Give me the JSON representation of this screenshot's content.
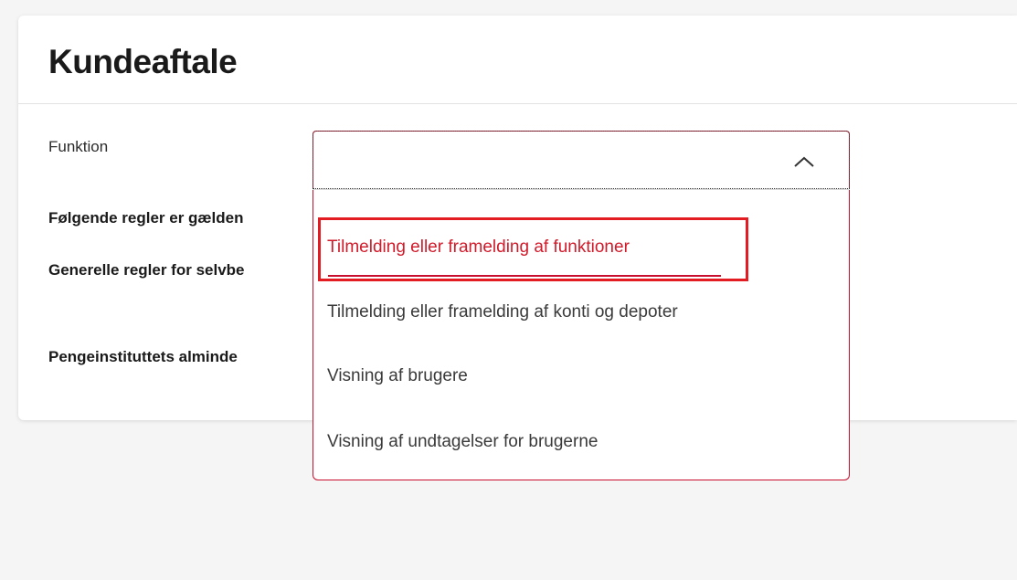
{
  "card": {
    "title": "Kundeaftale"
  },
  "form": {
    "field_label": "Funktion",
    "select_value": ""
  },
  "rules": [
    "Følgende regler er gælden",
    "Generelle regler for selvbe",
    "Pengeinstituttets alminde"
  ],
  "dropdown": {
    "options": [
      "Tilmelding eller framelding af funktioner",
      "Tilmelding eller framelding af konti og depoter",
      "Visning af brugere",
      "Visning af undtagelser for brugerne"
    ],
    "selected_index": 0
  },
  "colors": {
    "accent": "#c8102e",
    "highlight": "#e31b23",
    "selected_text": "#d11a2a",
    "option_text": "#3a3a3a",
    "page_bg": "#f5f5f5"
  },
  "icons": {
    "select_toggle": "chevron-up-icon"
  }
}
